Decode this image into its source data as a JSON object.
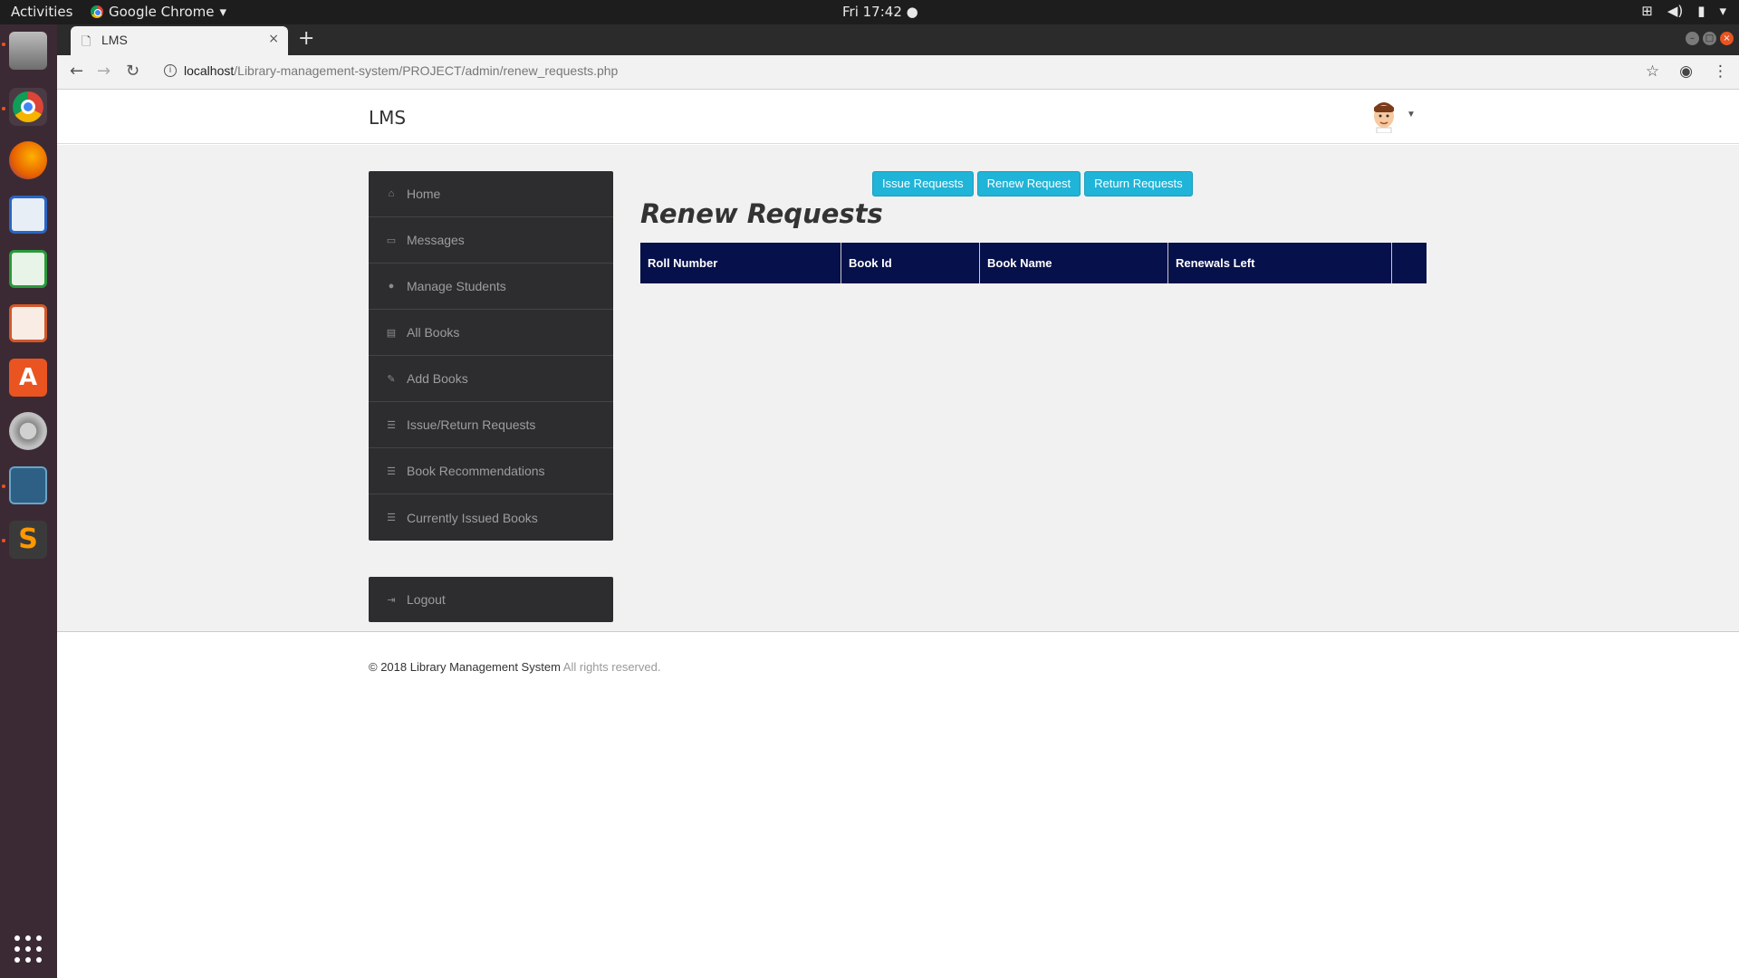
{
  "system": {
    "activities": "Activities",
    "app_name": "Google Chrome",
    "clock": "Fri 17:42 ●"
  },
  "browser": {
    "tab_title": "LMS",
    "tab_close": "×",
    "new_tab": "+",
    "url_host": "localhost",
    "url_path": "/Library-management-system/PROJECT/admin/renew_requests.php"
  },
  "header": {
    "brand": "LMS"
  },
  "sidebar": {
    "items": [
      {
        "label": "Home",
        "icon": "home-icon",
        "glyph": "⌂"
      },
      {
        "label": "Messages",
        "icon": "inbox-icon",
        "glyph": "▭"
      },
      {
        "label": "Manage Students",
        "icon": "user-icon",
        "glyph": "●"
      },
      {
        "label": "All Books",
        "icon": "book-icon",
        "glyph": "▤"
      },
      {
        "label": "Add Books",
        "icon": "edit-icon",
        "glyph": "✎"
      },
      {
        "label": "Issue/Return Requests",
        "icon": "list-icon",
        "glyph": "☰"
      },
      {
        "label": "Book Recommendations",
        "icon": "list-icon",
        "glyph": "☰"
      },
      {
        "label": "Currently Issued Books",
        "icon": "list-icon",
        "glyph": "☰"
      }
    ],
    "logout": "Logout"
  },
  "tabs_buttons": {
    "issue": "Issue Requests",
    "renew": "Renew Request",
    "return": "Return Requests"
  },
  "main": {
    "heading": "Renew Requests",
    "columns": [
      "Roll Number",
      "Book Id",
      "Book Name",
      "Renewals Left",
      ""
    ]
  },
  "footer": {
    "copyright": "© 2018 Library Management System",
    "rights": " All rights reserved."
  },
  "colors": {
    "table_header": "#06104a",
    "button": "#1fb4d8",
    "sidebar": "#2d2d30",
    "dock": "#3b2a34",
    "ubuntu_orange": "#e95420"
  }
}
